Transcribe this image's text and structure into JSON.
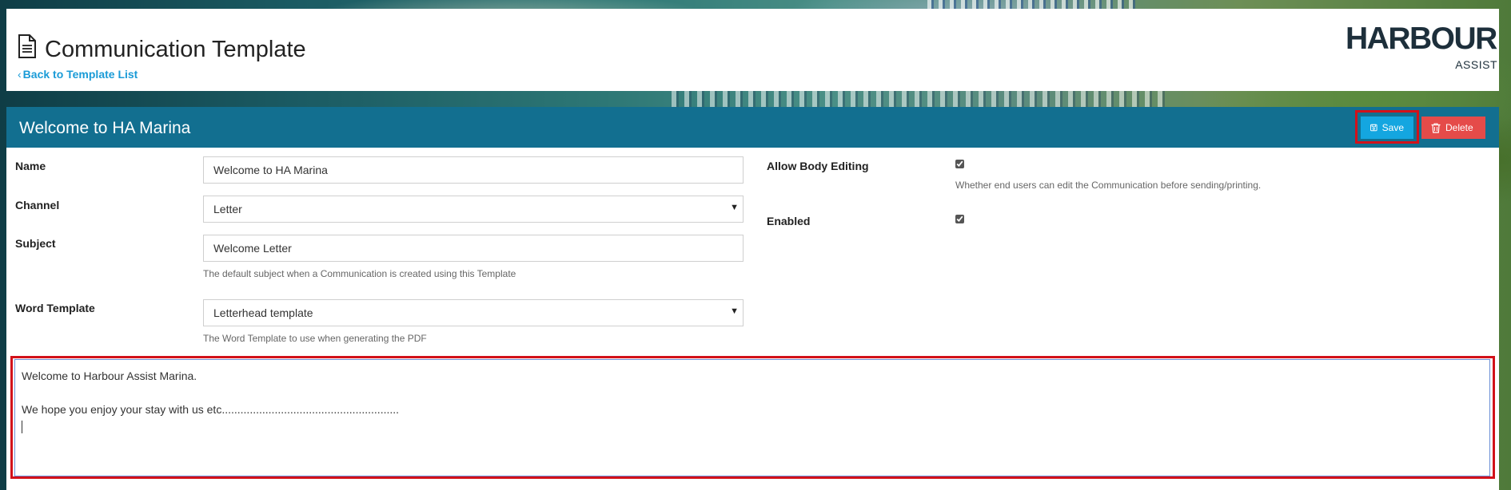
{
  "header": {
    "page_title": "Communication Template",
    "back_link": "Back to Template List",
    "logo": {
      "main": "HARBOUR",
      "sub": "ASSIST"
    }
  },
  "template": {
    "title": "Welcome to HA Marina",
    "actions": {
      "save_label": "Save",
      "delete_label": "Delete"
    }
  },
  "form": {
    "name": {
      "label": "Name",
      "value": "Welcome to HA Marina"
    },
    "channel": {
      "label": "Channel",
      "value": "Letter"
    },
    "subject": {
      "label": "Subject",
      "value": "Welcome Letter",
      "help": "The default subject when a Communication is created using this Template"
    },
    "word_template": {
      "label": "Word Template",
      "value": "Letterhead template",
      "help": "The Word Template to use when generating the PDF"
    },
    "allow_body_editing": {
      "label": "Allow Body Editing",
      "checked": true,
      "help": "Whether end users can edit the Communication before sending/printing."
    },
    "enabled": {
      "label": "Enabled",
      "checked": true
    }
  },
  "body": {
    "lines": [
      "Welcome to Harbour Assist Marina.",
      "",
      "We hope you enjoy your stay with us etc........................................................."
    ]
  },
  "colors": {
    "title_bar": "#126f90",
    "save": "#14a6e0",
    "delete": "#e54b49",
    "link": "#1a9bd7",
    "highlight": "#d2111a"
  }
}
